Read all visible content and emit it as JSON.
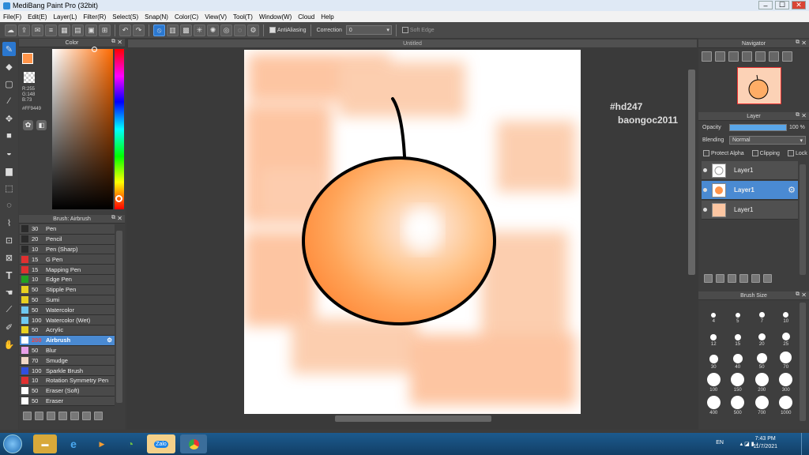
{
  "window": {
    "title": "MediBang Paint Pro (32bit)",
    "min": "–",
    "max": "☐",
    "close": "✕"
  },
  "menu": [
    "File(F)",
    "Edit(E)",
    "Layer(L)",
    "Filter(R)",
    "Select(S)",
    "Snap(N)",
    "Color(C)",
    "View(V)",
    "Tool(T)",
    "Window(W)",
    "Cloud",
    "Help"
  ],
  "toolbar": {
    "antialiasing_label": "AntiAliasing",
    "correction_label": "Correction",
    "correction_value": "0",
    "soft_edge_label": "Soft Edge"
  },
  "color_panel": {
    "title": "Color",
    "r": "R:255",
    "g": "G:148",
    "b": "B:73",
    "hex": "#FF9449",
    "primary_color": "#ff9449",
    "secondary_color": "#ffffff"
  },
  "brush_panel": {
    "title": "Brush: Airbrush",
    "items": [
      {
        "size": "30",
        "name": "Pen",
        "color": "#2a2a2a"
      },
      {
        "size": "20",
        "name": "Pencil",
        "color": "#2a2a2a"
      },
      {
        "size": "10",
        "name": "Pen (Sharp)",
        "color": "#2a2a2a"
      },
      {
        "size": "15",
        "name": "G Pen",
        "color": "#e03030"
      },
      {
        "size": "15",
        "name": "Mapping Pen",
        "color": "#e03030"
      },
      {
        "size": "10",
        "name": "Edge Pen",
        "color": "#22a022"
      },
      {
        "size": "50",
        "name": "Stipple Pen",
        "color": "#e8d020"
      },
      {
        "size": "50",
        "name": "Sumi",
        "color": "#e8d020"
      },
      {
        "size": "50",
        "name": "Watercolor",
        "color": "#6ec8f0"
      },
      {
        "size": "100",
        "name": "Watercolor (Wet)",
        "color": "#6ec8f0"
      },
      {
        "size": "50",
        "name": "Acrylic",
        "color": "#e8d020"
      },
      {
        "size": "200",
        "name": "Airbrush",
        "color": "#ffffff"
      },
      {
        "size": "50",
        "name": "Blur",
        "color": "#e8a0e8"
      },
      {
        "size": "70",
        "name": "Smudge",
        "color": "#f0d8c8"
      },
      {
        "size": "100",
        "name": "Sparkle Brush",
        "color": "#3050e0"
      },
      {
        "size": "10",
        "name": "Rotation Symmetry Pen",
        "color": "#e03030"
      },
      {
        "size": "50",
        "name": "Eraser (Soft)",
        "color": "#ffffff"
      },
      {
        "size": "50",
        "name": "Eraser",
        "color": "#ffffff"
      }
    ],
    "selected_index": 11
  },
  "canvas": {
    "tab_title": "Untitled",
    "watermark_line1": "#hd247",
    "watermark_line2": "baongoc2011"
  },
  "navigator": {
    "title": "Navigator"
  },
  "layer_panel": {
    "title": "Layer",
    "opacity_label": "Opacity",
    "opacity_value": "100 %",
    "opacity_fraction": 1.0,
    "blending_label": "Blending",
    "blending_value": "Normal",
    "protect_alpha": "Protect Alpha",
    "clipping": "Clipping",
    "lock": "Lock",
    "layers": [
      {
        "name": "Layer1",
        "selected": false
      },
      {
        "name": "Layer1",
        "selected": true
      },
      {
        "name": "Layer1",
        "selected": false
      }
    ]
  },
  "brush_size_panel": {
    "title": "Brush Size",
    "sizes": [
      "4",
      "5",
      "7",
      "10",
      "12",
      "15",
      "20",
      "25",
      "30",
      "40",
      "50",
      "70",
      "100",
      "150",
      "200",
      "300",
      "400",
      "500",
      "700",
      "1000"
    ]
  },
  "taskbar": {
    "lang": "EN",
    "time": "7:43 PM",
    "date": "11/7/2021",
    "zalo": "Zalo"
  }
}
